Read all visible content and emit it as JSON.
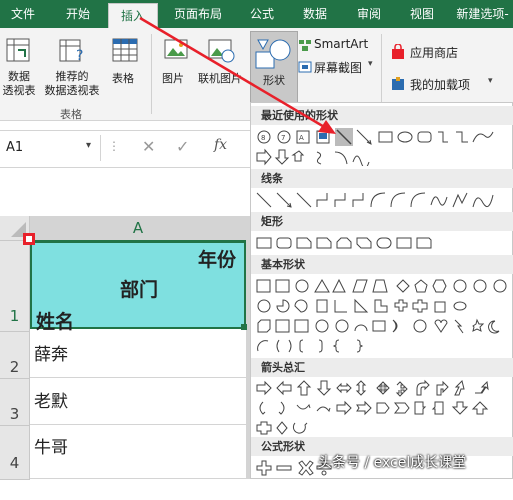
{
  "tabs": [
    "文件",
    "开始",
    "插入",
    "页面布局",
    "公式",
    "数据",
    "审阅",
    "视图",
    "新建选项-"
  ],
  "active_tab": "插入",
  "ribbon": {
    "pivot_label": "数据\n透视表",
    "recommended_pivot_label": "推荐的\n数据透视表",
    "table_label": "表格",
    "group_tables": "表格",
    "picture_label": "图片",
    "online_picture_label": "联机图片",
    "shapes_label": "形状",
    "smartart_label": "SmartArt",
    "screenshot_label": "屏幕截图",
    "store_label": "应用商店",
    "my_addins_label": "我的加载项"
  },
  "formula_bar": {
    "name_box": "A1",
    "fx": "fx"
  },
  "sheet": {
    "column_header": "A",
    "rows": [
      {
        "num": "1",
        "header_top": "年份",
        "header_mid": "部门",
        "header_bottom": "姓名"
      },
      {
        "num": "2",
        "value": "薛奔"
      },
      {
        "num": "3",
        "value": "老默"
      },
      {
        "num": "4",
        "value": "牛哥"
      }
    ],
    "cell_fill": "#7fe0e0"
  },
  "shapes_menu": {
    "sections": [
      "最近使用的形状",
      "线条",
      "矩形",
      "基本形状",
      "箭头总汇",
      "公式形状"
    ]
  },
  "watermark": "头条号 / excel成长课堂",
  "colors": {
    "excel_green": "#217346",
    "annotation_red": "#e8202a"
  }
}
